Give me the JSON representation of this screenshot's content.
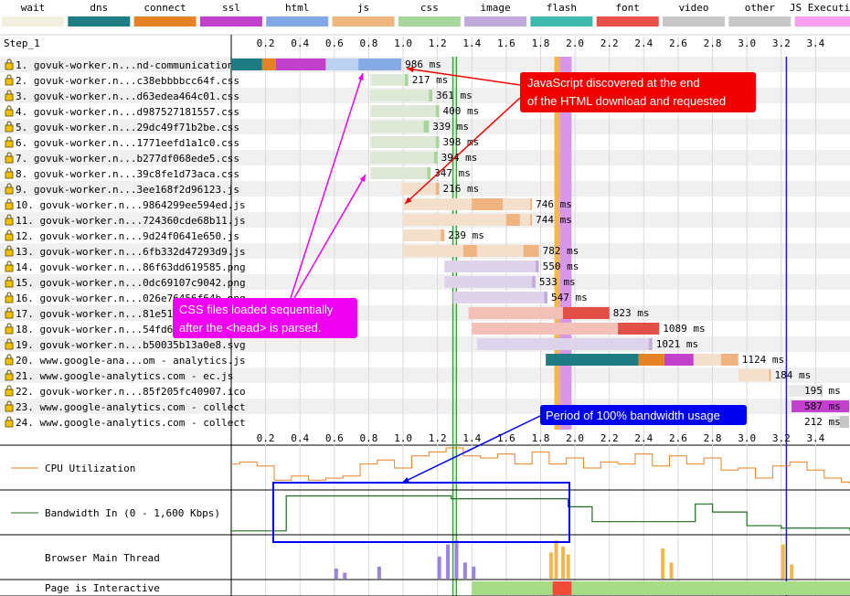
{
  "legend": [
    {
      "name": "wait",
      "color": "#f2efdf"
    },
    {
      "name": "dns",
      "color": "#1f7c83"
    },
    {
      "name": "connect",
      "color": "#e58226"
    },
    {
      "name": "ssl",
      "color": "#c141cd"
    },
    {
      "name": "html",
      "color": "#82a8e8"
    },
    {
      "name": "js",
      "color": "#f0b680"
    },
    {
      "name": "css",
      "color": "#a6d69a"
    },
    {
      "name": "image",
      "color": "#c0aadd"
    },
    {
      "name": "flash",
      "color": "#3fb8b0"
    },
    {
      "name": "font",
      "color": "#e85048"
    },
    {
      "name": "video",
      "color": "#c8c8c8"
    },
    {
      "name": "other",
      "color": "#c8c8c8"
    },
    {
      "name": "JS Execution",
      "color": "#fba0ef"
    }
  ],
  "step_label": "Step_1",
  "row_labels": [
    "1. govuk-worker.n...nd-communications",
    "2. govuk-worker.n...c38ebbbbcc64f.css",
    "3. govuk-worker.n...d63edea464c01.css",
    "4. govuk-worker.n...d987527181557.css",
    "5. govuk-worker.n...29dc49f71b2be.css",
    "6. govuk-worker.n...1771eefd1a1c0.css",
    "7. govuk-worker.n...b277df068ede5.css",
    "8. govuk-worker.n...39c8fe1d73aca.css",
    "9. govuk-worker.n...3ee168f2d96123.js",
    "10. govuk-worker.n...9864299ee594ed.js",
    "11. govuk-worker.n...724360cde68b11.js",
    "12. govuk-worker.n...9d24f0641e650.js",
    "13. govuk-worker.n...6fb332d47293d9.js",
    "14. govuk-worker.n...86f63dd619585.png",
    "15. govuk-worker.n...0dc69107c9042.png",
    "16. govuk-worker.n...026e76456f64b.png",
    "17. govuk-worker.n...81e51183",
    "18. govuk-worker.n...54fd691",
    "19. govuk-worker.n...b50035b13a0e8.svg",
    "20. www.google-ana...om - analytics.js",
    "21. www.google-analytics.com - ec.js",
    "22. govuk-worker.n...85f205fc40907.ico",
    "23. www.google-analytics.com - collect",
    "24. www.google-analytics.com - collect"
  ],
  "chart_data": {
    "type": "waterfall",
    "x_ticks": [
      "0.2",
      "0.4",
      "0.6",
      "0.8",
      "1.0",
      "1.2",
      "1.4",
      "1.6",
      "1.8",
      "2.0",
      "2.2",
      "2.4",
      "2.6",
      "2.8",
      "3.0",
      "3.2",
      "3.4"
    ],
    "xlim": [
      0,
      3.6
    ],
    "markers": {
      "green_lines": [
        1.29,
        1.31
      ],
      "orange_band": [
        1.88,
        1.91
      ],
      "purple_band": [
        1.91,
        1.98
      ],
      "blue_line": 3.23
    },
    "requests": [
      {
        "row": 1,
        "start": 0.0,
        "duration_ms": 986,
        "label": "986 ms",
        "segments": [
          {
            "type": "dns",
            "from": 0.0,
            "to": 0.18
          },
          {
            "type": "connect",
            "from": 0.18,
            "to": 0.26
          },
          {
            "type": "ssl",
            "from": 0.26,
            "to": 0.55
          },
          {
            "type": "html_wait",
            "from": 0.55,
            "to": 0.74
          },
          {
            "type": "html",
            "from": 0.74,
            "to": 0.99
          }
        ]
      },
      {
        "row": 2,
        "start": 0.81,
        "duration_ms": 217,
        "label": "217 ms",
        "segments": [
          {
            "type": "css_wait",
            "from": 0.81,
            "to": 1.01
          },
          {
            "type": "css",
            "from": 1.01,
            "to": 1.03
          }
        ]
      },
      {
        "row": 3,
        "start": 0.81,
        "duration_ms": 361,
        "label": "361 ms",
        "segments": [
          {
            "type": "css_wait",
            "from": 0.81,
            "to": 1.15
          },
          {
            "type": "css",
            "from": 1.15,
            "to": 1.17
          }
        ]
      },
      {
        "row": 4,
        "start": 0.81,
        "duration_ms": 400,
        "label": "400 ms",
        "segments": [
          {
            "type": "css_wait",
            "from": 0.81,
            "to": 1.19
          },
          {
            "type": "css",
            "from": 1.19,
            "to": 1.21
          }
        ]
      },
      {
        "row": 5,
        "start": 0.81,
        "duration_ms": 339,
        "label": "339 ms",
        "segments": [
          {
            "type": "css_wait",
            "from": 0.81,
            "to": 1.12
          },
          {
            "type": "css",
            "from": 1.12,
            "to": 1.15
          }
        ]
      },
      {
        "row": 6,
        "start": 0.81,
        "duration_ms": 398,
        "label": "398 ms",
        "segments": [
          {
            "type": "css_wait",
            "from": 0.81,
            "to": 1.19
          },
          {
            "type": "css",
            "from": 1.19,
            "to": 1.21
          }
        ]
      },
      {
        "row": 7,
        "start": 0.81,
        "duration_ms": 394,
        "label": "394 ms",
        "segments": [
          {
            "type": "css_wait",
            "from": 0.81,
            "to": 1.18
          },
          {
            "type": "css",
            "from": 1.18,
            "to": 1.2
          }
        ]
      },
      {
        "row": 8,
        "start": 0.81,
        "duration_ms": 347,
        "label": "347 ms",
        "segments": [
          {
            "type": "css_wait",
            "from": 0.81,
            "to": 1.14
          },
          {
            "type": "css",
            "from": 1.14,
            "to": 1.16
          }
        ]
      },
      {
        "row": 9,
        "start": 0.99,
        "duration_ms": 216,
        "label": "216 ms",
        "segments": [
          {
            "type": "js_wait",
            "from": 0.99,
            "to": 1.19
          },
          {
            "type": "js",
            "from": 1.19,
            "to": 1.21
          }
        ]
      },
      {
        "row": 10,
        "start": 1.0,
        "duration_ms": 746,
        "label": "746 ms",
        "segments": [
          {
            "type": "js_wait",
            "from": 1.0,
            "to": 1.4
          },
          {
            "type": "js",
            "from": 1.4,
            "to": 1.58
          },
          {
            "type": "js_wait",
            "from": 1.58,
            "to": 1.74
          },
          {
            "type": "js",
            "from": 1.74,
            "to": 1.75
          }
        ]
      },
      {
        "row": 11,
        "start": 1.0,
        "duration_ms": 744,
        "label": "744 ms",
        "segments": [
          {
            "type": "js_wait",
            "from": 1.0,
            "to": 1.6
          },
          {
            "type": "js",
            "from": 1.6,
            "to": 1.68
          },
          {
            "type": "js_wait",
            "from": 1.68,
            "to": 1.74
          },
          {
            "type": "js",
            "from": 1.74,
            "to": 1.75
          }
        ]
      },
      {
        "row": 12,
        "start": 1.0,
        "duration_ms": 239,
        "label": "239 ms",
        "segments": [
          {
            "type": "js_wait",
            "from": 1.0,
            "to": 1.22
          },
          {
            "type": "js",
            "from": 1.22,
            "to": 1.24
          }
        ]
      },
      {
        "row": 13,
        "start": 1.0,
        "duration_ms": 782,
        "label": "782 ms",
        "segments": [
          {
            "type": "js_wait",
            "from": 1.0,
            "to": 1.35
          },
          {
            "type": "js",
            "from": 1.35,
            "to": 1.43
          },
          {
            "type": "js_wait",
            "from": 1.43,
            "to": 1.7
          },
          {
            "type": "js",
            "from": 1.7,
            "to": 1.79
          }
        ]
      },
      {
        "row": 14,
        "start": 1.24,
        "duration_ms": 550,
        "label": "550 ms",
        "segments": [
          {
            "type": "image_wait",
            "from": 1.24,
            "to": 1.77
          },
          {
            "type": "image",
            "from": 1.77,
            "to": 1.79
          }
        ]
      },
      {
        "row": 15,
        "start": 1.24,
        "duration_ms": 533,
        "label": "533 ms",
        "segments": [
          {
            "type": "image_wait",
            "from": 1.24,
            "to": 1.75
          },
          {
            "type": "image",
            "from": 1.75,
            "to": 1.77
          }
        ]
      },
      {
        "row": 16,
        "start": 1.29,
        "duration_ms": 547,
        "label": "547 ms",
        "segments": [
          {
            "type": "image_wait",
            "from": 1.29,
            "to": 1.82
          },
          {
            "type": "image",
            "from": 1.82,
            "to": 1.84
          }
        ]
      },
      {
        "row": 17,
        "start": 1.38,
        "duration_ms": 823,
        "label": "823 ms",
        "segments": [
          {
            "type": "font_wait",
            "from": 1.38,
            "to": 1.93
          },
          {
            "type": "font",
            "from": 1.93,
            "to": 2.2
          }
        ]
      },
      {
        "row": 18,
        "start": 1.4,
        "duration_ms": 1089,
        "label": "1089 ms",
        "segments": [
          {
            "type": "font_wait",
            "from": 1.4,
            "to": 2.25
          },
          {
            "type": "font",
            "from": 2.25,
            "to": 2.49
          }
        ]
      },
      {
        "row": 19,
        "start": 1.43,
        "duration_ms": 1021,
        "label": "1021 ms",
        "segments": [
          {
            "type": "image_wait",
            "from": 1.43,
            "to": 2.43
          },
          {
            "type": "image",
            "from": 2.43,
            "to": 2.45
          }
        ]
      },
      {
        "row": 20,
        "start": 1.83,
        "duration_ms": 1124,
        "label": "1124 ms",
        "segments": [
          {
            "type": "dns",
            "from": 1.83,
            "to": 2.37
          },
          {
            "type": "connect",
            "from": 2.37,
            "to": 2.52
          },
          {
            "type": "ssl",
            "from": 2.52,
            "to": 2.69
          },
          {
            "type": "js_wait",
            "from": 2.69,
            "to": 2.85
          },
          {
            "type": "js",
            "from": 2.85,
            "to": 2.95
          }
        ]
      },
      {
        "row": 21,
        "start": 2.95,
        "duration_ms": 184,
        "label": "184 ms",
        "segments": [
          {
            "type": "js_wait",
            "from": 2.95,
            "to": 3.13
          },
          {
            "type": "js",
            "from": 3.13,
            "to": 3.14
          }
        ]
      },
      {
        "row": 22,
        "start": 3.24,
        "duration_ms": 195,
        "label": "195 ms",
        "segments": [
          {
            "type": "other_wait",
            "from": 3.24,
            "to": 3.43
          },
          {
            "type": "other",
            "from": 3.43,
            "to": 3.44
          }
        ]
      },
      {
        "row": 23,
        "start": 3.24,
        "duration_ms": 587,
        "label": "587 ms",
        "segments": [
          {
            "type": "other_wait",
            "from": 3.24,
            "to": 3.26
          },
          {
            "type": "ssl",
            "from": 3.26,
            "to": 3.6
          }
        ]
      },
      {
        "row": 24,
        "start": 3.48,
        "duration_ms": 212,
        "label": "212 ms",
        "segments": [
          {
            "type": "other_wait",
            "from": 3.48,
            "to": 3.54
          },
          {
            "type": "other",
            "from": 3.54,
            "to": 3.6
          }
        ]
      }
    ],
    "cpu_utilization": [
      [
        0,
        0.6
      ],
      [
        0.05,
        0.65
      ],
      [
        0.15,
        0.55
      ],
      [
        0.25,
        0.2
      ],
      [
        0.35,
        0.3
      ],
      [
        0.45,
        0.2
      ],
      [
        0.55,
        0.25
      ],
      [
        0.65,
        0.3
      ],
      [
        0.75,
        0.6
      ],
      [
        0.85,
        0.7
      ],
      [
        0.95,
        0.5
      ],
      [
        1.05,
        0.8
      ],
      [
        1.15,
        0.9
      ],
      [
        1.25,
        1.0
      ],
      [
        1.35,
        0.8
      ],
      [
        1.45,
        0.75
      ],
      [
        1.55,
        0.85
      ],
      [
        1.65,
        0.6
      ],
      [
        1.75,
        0.9
      ],
      [
        1.85,
        0.6
      ],
      [
        1.95,
        0.75
      ],
      [
        2.05,
        0.5
      ],
      [
        2.15,
        0.65
      ],
      [
        2.25,
        0.6
      ],
      [
        2.35,
        0.85
      ],
      [
        2.45,
        0.55
      ],
      [
        2.55,
        0.8
      ],
      [
        2.65,
        0.6
      ],
      [
        2.75,
        0.75
      ],
      [
        2.85,
        0.45
      ],
      [
        2.95,
        0.5
      ],
      [
        3.05,
        0.25
      ],
      [
        3.15,
        0.55
      ],
      [
        3.25,
        0.65
      ],
      [
        3.35,
        0.45
      ],
      [
        3.45,
        0.25
      ],
      [
        3.55,
        0.15
      ],
      [
        3.6,
        0.1
      ]
    ],
    "bandwidth_in": [
      [
        0,
        0.05
      ],
      [
        0.3,
        0.05
      ],
      [
        0.32,
        0.92
      ],
      [
        1.25,
        0.92
      ],
      [
        1.28,
        0.85
      ],
      [
        1.9,
        0.85
      ],
      [
        1.96,
        0.65
      ],
      [
        2.1,
        0.28
      ],
      [
        2.3,
        0.28
      ],
      [
        2.7,
        0.72
      ],
      [
        2.8,
        0.52
      ],
      [
        3.0,
        0.18
      ],
      [
        3.2,
        0.12
      ],
      [
        3.4,
        0.12
      ],
      [
        3.6,
        0.05
      ]
    ],
    "main_thread_bursts": [
      [
        0.6,
        0.25
      ],
      [
        0.65,
        0.15
      ],
      [
        0.85,
        0.3
      ],
      [
        1.2,
        0.55
      ],
      [
        1.25,
        0.85
      ],
      [
        1.3,
        0.95
      ],
      [
        1.35,
        0.4
      ],
      [
        1.4,
        0.3
      ],
      [
        1.85,
        0.65
      ],
      [
        1.88,
        0.95
      ],
      [
        1.92,
        0.8
      ],
      [
        1.95,
        0.6
      ],
      [
        2.5,
        0.75
      ],
      [
        2.55,
        0.4
      ],
      [
        3.2,
        0.85
      ],
      [
        3.25,
        0.35
      ]
    ],
    "interactive": {
      "start": 1.4,
      "end": 3.6,
      "blocked": [
        1.87,
        1.98
      ]
    }
  },
  "bottom_labels": {
    "cpu": "CPU Utilization",
    "bandwidth": "Bandwidth In (0 - 1,600 Kbps)",
    "main_thread": "Browser Main Thread",
    "interactive": "Page is Interactive"
  },
  "annotations": {
    "js_discovered": "JavaScript discovered at the end|of the HTML download and requested",
    "css_sequential": "CSS files loaded sequentially|after the <head> is parsed.",
    "bandwidth": "Period of 100% bandwidth usage"
  }
}
